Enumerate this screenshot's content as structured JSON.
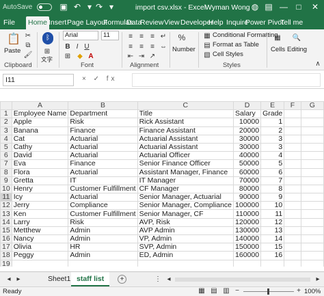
{
  "titlebar": {
    "autosave": "AutoSave",
    "toggle_state": "Off",
    "document": "import csv.xlsx  -  Excel",
    "user": "Wyman Wong"
  },
  "ribbon_tabs": [
    "File",
    "Home",
    "Insert",
    "Page Layout",
    "Formulas",
    "Data",
    "Review",
    "View",
    "Developer",
    "Help",
    "Inquire",
    "Power Pivot",
    "Tell me"
  ],
  "active_tab": "Home",
  "ribbon": {
    "paste": "Paste",
    "font_name": "Arial",
    "font_size": "11",
    "clipboard": "Clipboard",
    "font": "Font",
    "alignment": "Alignment",
    "number": "Number",
    "conditional_formatting": "Conditional Formatting",
    "format_as_table": "Format as Table",
    "cell_styles": "Cell Styles",
    "styles": "Styles",
    "cells": "Cells",
    "editing": "Editing",
    "bold": "B",
    "italic": "I",
    "underline": "U",
    "font_color_letter": "A",
    "phonetic": "文字",
    "percent": "%"
  },
  "formula_bar": {
    "namebox": "I11",
    "fx": "×  ✓  fx",
    "value": ""
  },
  "grid": {
    "columns": [
      "A",
      "B",
      "C",
      "D",
      "E",
      "F",
      "G"
    ],
    "selected_row": 11,
    "rows": [
      [
        "Employee Name",
        "Department",
        "Title",
        "Salary",
        "Grade",
        "",
        ""
      ],
      [
        "Apple",
        "Risk",
        "Rick Assistant",
        "10000",
        "1",
        "",
        ""
      ],
      [
        "Banana",
        "Finance",
        "Finance Assistant",
        "20000",
        "2",
        "",
        ""
      ],
      [
        "Cat",
        "Actuarial",
        "Actuarial Assistant",
        "30000",
        "3",
        "",
        ""
      ],
      [
        "Cathy",
        "Actuarial",
        "Actuarial Assistant",
        "30000",
        "3",
        "",
        ""
      ],
      [
        "David",
        "Actuarial",
        "Actuarial Officer",
        "40000",
        "4",
        "",
        ""
      ],
      [
        "Eva",
        "Finance",
        "Senior Finance Officer",
        "50000",
        "5",
        "",
        ""
      ],
      [
        "Flora",
        "Actuarial",
        "Assistant Manager, Finance",
        "60000",
        "6",
        "",
        ""
      ],
      [
        "Gretta",
        "IT",
        "IT Manager",
        "70000",
        "7",
        "",
        ""
      ],
      [
        "Henry",
        "Customer Fulfillment",
        "CF Manager",
        "80000",
        "8",
        "",
        ""
      ],
      [
        "Icy",
        "Actuarial",
        "Senior Manager, Actuarial",
        "90000",
        "9",
        "",
        ""
      ],
      [
        "Jerry",
        "Compliance",
        "Senior Manager, Compliance",
        "100000",
        "10",
        "",
        ""
      ],
      [
        "Ken",
        "Customer Fulfillment",
        "Senior Manager, CF",
        "110000",
        "11",
        "",
        ""
      ],
      [
        "Larry",
        "Risk",
        "AVP, Risk",
        "120000",
        "12",
        "",
        ""
      ],
      [
        "Metthew",
        "Admin",
        "AVP Admin",
        "130000",
        "13",
        "",
        ""
      ],
      [
        "Nancy",
        "Admin",
        "VP, Admin",
        "140000",
        "14",
        "",
        ""
      ],
      [
        "Olivia",
        "HR",
        "SVP, Admin",
        "150000",
        "15",
        "",
        ""
      ],
      [
        "Peggy",
        "Admin",
        "ED, Admin",
        "160000",
        "16",
        "",
        ""
      ],
      [
        "",
        "",
        "",
        "",
        "",
        "",
        ""
      ],
      [
        "",
        "",
        "",
        "",
        "",
        "",
        ""
      ]
    ]
  },
  "sheets": [
    "Sheet1",
    "staff list"
  ],
  "active_sheet": "staff list",
  "status": {
    "ready": "Ready",
    "zoom": "100%"
  },
  "colors": {
    "brand": "#217346",
    "font_color_bar": "#c00000"
  }
}
